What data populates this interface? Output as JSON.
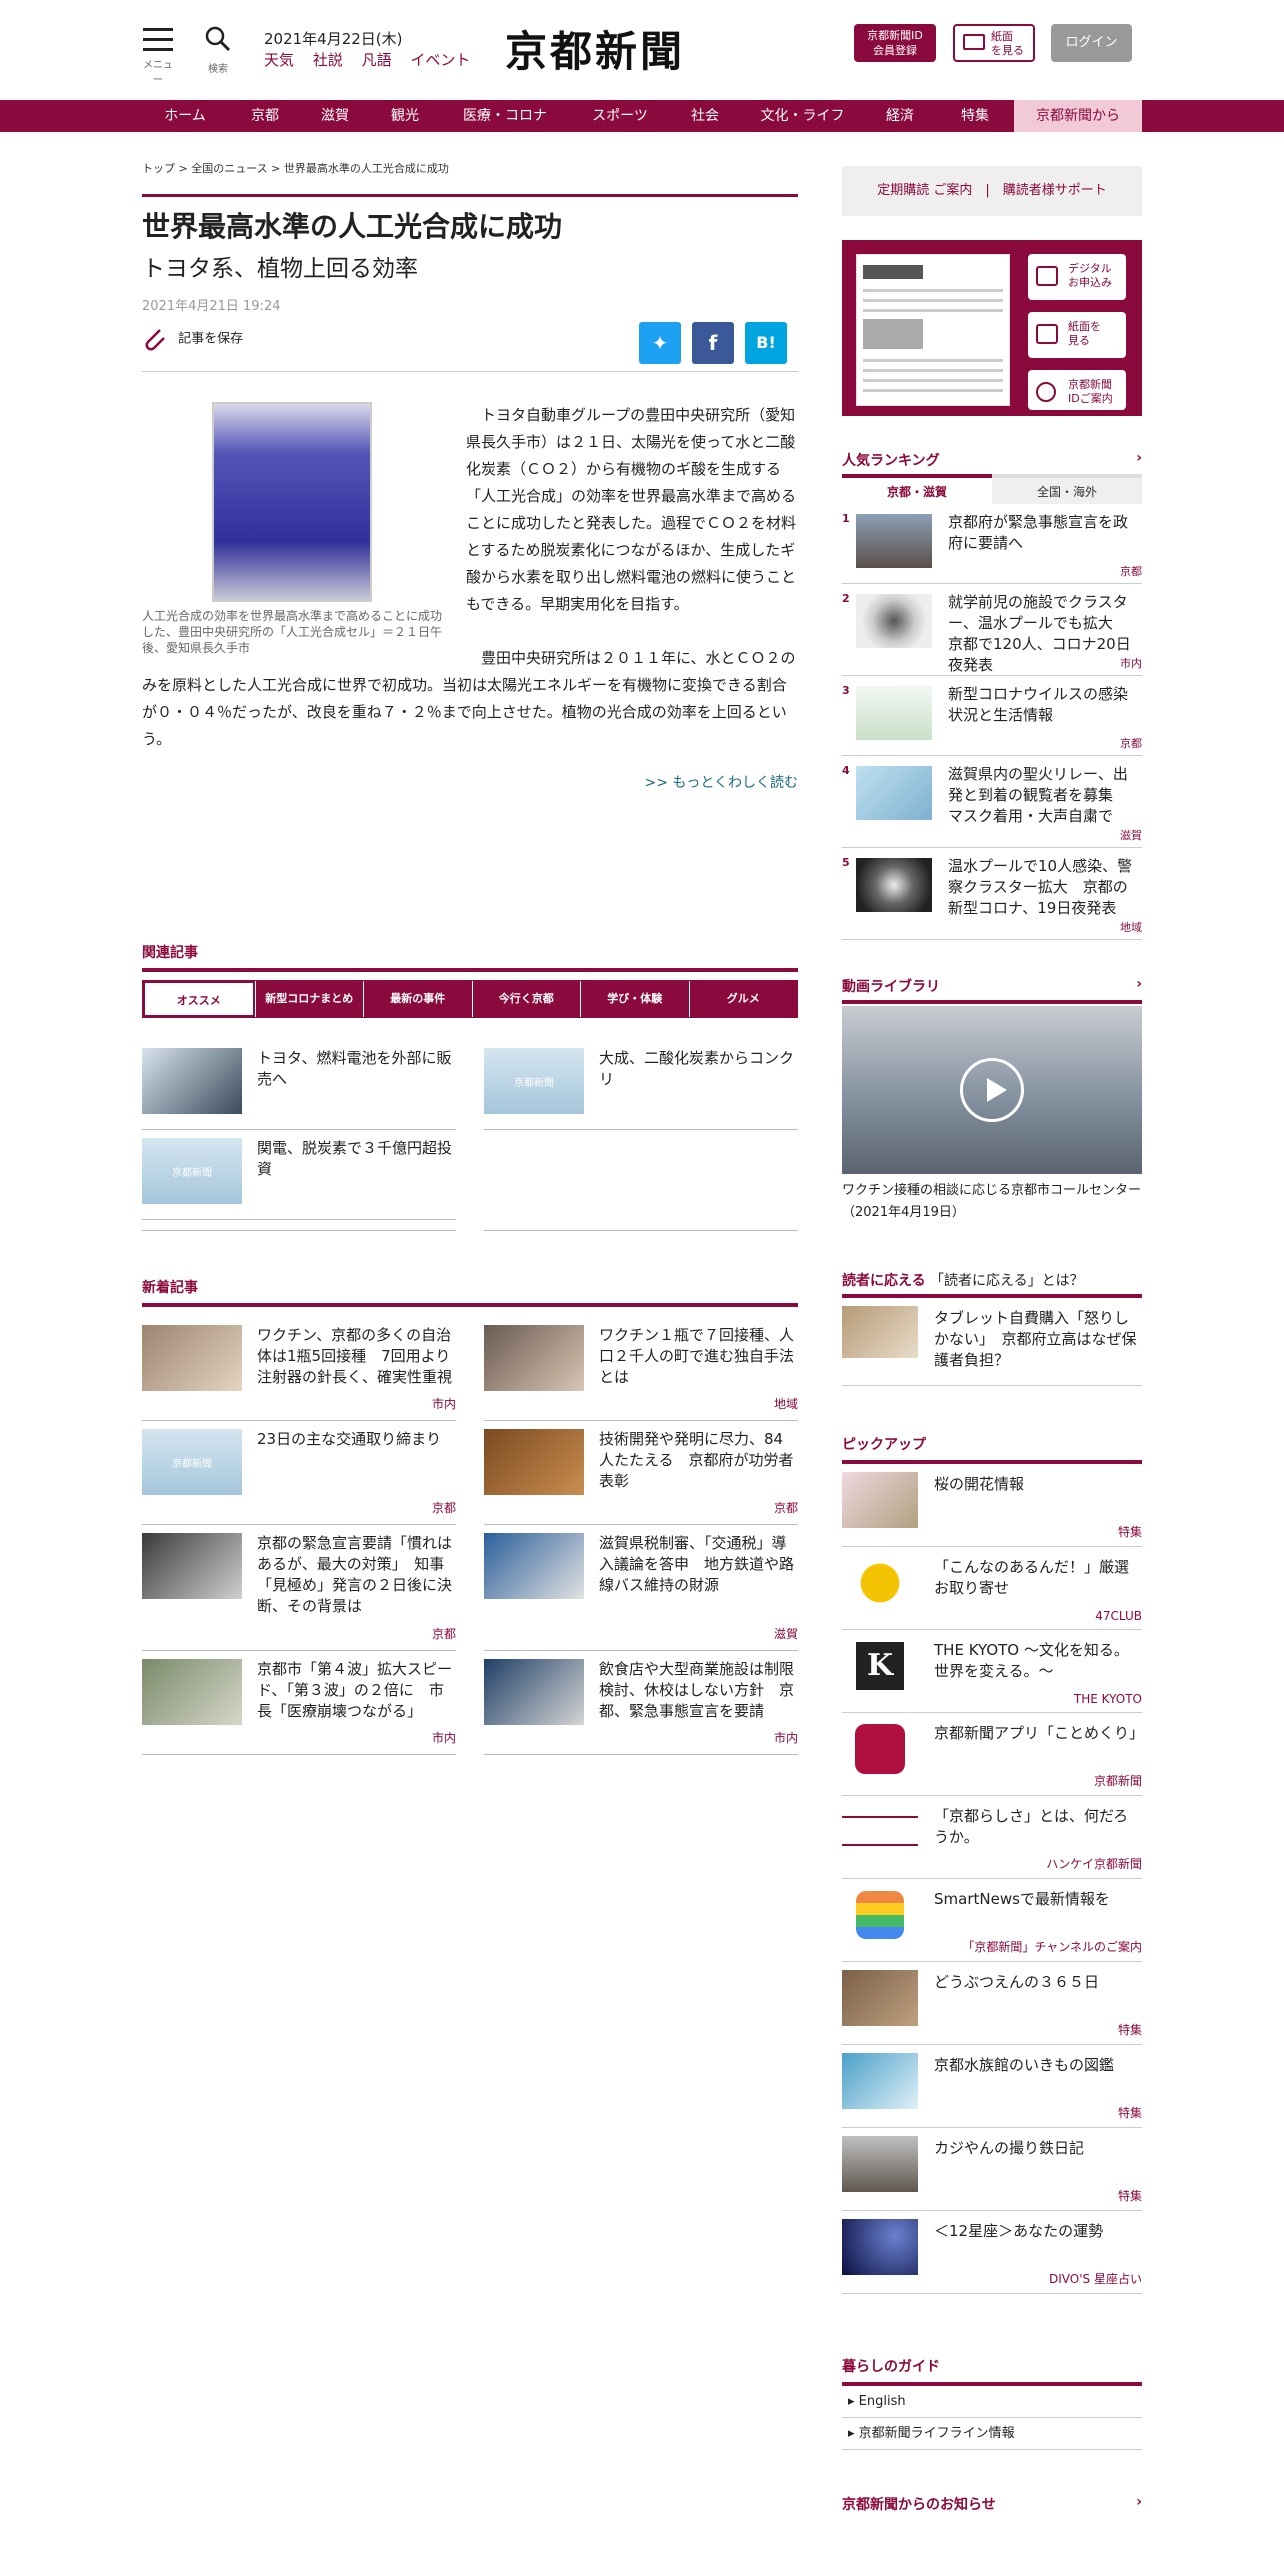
{
  "header": {
    "menu_label": "メニュー",
    "search_label": "検索",
    "date": "2021年4月22日(木)",
    "links": [
      "天気",
      "社説",
      "凡語",
      "イベント"
    ],
    "logo": "京都新聞",
    "id_button": "京都新聞ID\n会員登録",
    "paper_button": "紙面\nを見る",
    "login_button": "ログイン"
  },
  "nav": [
    "ホーム",
    "京都",
    "滋賀",
    "観光",
    "医療・コロナ",
    "スポーツ",
    "社会",
    "文化・ライフ",
    "経済",
    "特集",
    "京都新聞から"
  ],
  "article": {
    "breadcrumb": [
      "トップ",
      "全国のニュース",
      "世界最高水準の人工光合成に成功"
    ],
    "title": "世界最高水準の人工光合成に成功",
    "subtitle": "トヨタ系、植物上回る効率",
    "date": "2021年4月21日 19:24",
    "save_label": "記事を保存",
    "caption": "人工光合成の効率を世界最高水準まで高めることに成功した、豊田中央研究所の「人工光合成セル」＝２１日午後、愛知県長久手市",
    "para1": "トヨタ自動車グループの豊田中央研究所（愛知県長久手市）は２１日、太陽光を使って水と二酸化炭素（ＣＯ２）から有機物のギ酸を生成する「人工光合成」の効率を世界最高水準まで高めることに成功したと発表した。過程でＣＯ２を材料とするため脱炭素化につながるほか、生成したギ酸から水素を取り出し燃料電池の燃料に使うこともできる。早期実用化を目指す。",
    "para2": "豊田中央研究所は２０１１年に、水とＣＯ２のみを原料とした人工光合成に世界で初成功。当初は太陽光エネルギーを有機物に変換できる割合が０・０４％だったが、改良を重ね７・２％まで向上させた。植物の光合成の効率を上回るという。",
    "more": ">> もっとくわしく読む"
  },
  "related": {
    "heading": "関連記事",
    "tabs": [
      "オススメ",
      "新型コロナまとめ",
      "最新の事件",
      "今行く京都",
      "学び・体験",
      "グルメ"
    ],
    "items": [
      "トヨタ、燃料電池を外部に販売へ",
      "大成、二酸化炭素からコンクリ",
      "関電、脱炭素で３千億円超投資"
    ]
  },
  "latest": {
    "heading": "新着記事",
    "items": [
      {
        "title": "ワクチン、京都の多くの自治体は1瓶5回接種　7回用より注射器の針長く、確実性重視",
        "tag": "市内"
      },
      {
        "title": "ワクチン１瓶で７回接種、人口２千人の町で進む独自手法とは",
        "tag": "地域"
      },
      {
        "title": "23日の主な交通取り締まり",
        "tag": "京都"
      },
      {
        "title": "技術開発や発明に尽力、84人たたえる　京都府が功労者表彰",
        "tag": "京都"
      },
      {
        "title": "京都の緊急宣言要請「慣れはあるが、最大の対策」　知事「見極め」発言の２日後に決断、その背景は",
        "tag": "京都"
      },
      {
        "title": "滋賀県税制審、「交通税」導入議論を答申　地方鉄道や路線バス維持の財源",
        "tag": "滋賀"
      },
      {
        "title": "京都市「第４波」拡大スピード、「第３波」の２倍に　市長「医療崩壊つながる」",
        "tag": "市内"
      },
      {
        "title": "飲食店や大型商業施設は制限検討、休校はしない方針　京都、緊急事態宣言を要請",
        "tag": "市内"
      }
    ]
  },
  "sidebar": {
    "subscribe": "定期購読 ご案内",
    "support": "購読者様サポート",
    "epaper_buttons": [
      "デジタル\nお申込み",
      "紙面を\n見る",
      "京都新聞\nIDご案内"
    ],
    "ranking_heading": "人気ランキング",
    "ranking_tabs": [
      "京都・滋賀",
      "全国・海外"
    ],
    "ranking": [
      {
        "no": "1",
        "title": "京都府が緊急事態宣言を政府に要請へ",
        "tag": "京都"
      },
      {
        "no": "2",
        "title": "就学前児の施設でクラスター、温水プールでも拡大　京都で120人、コロナ20日夜発表",
        "tag": "市内"
      },
      {
        "no": "3",
        "title": "新型コロナウイルスの感染状況と生活情報",
        "tag": "京都"
      },
      {
        "no": "4",
        "title": "滋賀県内の聖火リレー、出発と到着の観覧者を募集　マスク着用・大声自粛で",
        "tag": "滋賀"
      },
      {
        "no": "5",
        "title": "温水プールで10人感染、警察クラスター拡大　京都の新型コロナ、19日夜発表",
        "tag": "地域"
      }
    ],
    "video_heading": "動画ライブラリ",
    "video_caption": "ワクチン接種の相談に応じる京都市コールセンター（2021年4月19日）",
    "reader_heading": "読者に応える",
    "reader_sub": "「読者に応える」とは？",
    "reader_item": "タブレット自費購入「怒りしかない」　京都府立高はなぜ保護者負担？",
    "pickup_heading": "ピックアップ",
    "pickup": [
      {
        "title": "桜の開花情報",
        "tag": "特集"
      },
      {
        "title": "「こんなのあるんだ！」厳選お取り寄せ",
        "tag": "47CLUB"
      },
      {
        "title": "THE KYOTO ～文化を知る。世界を変える。～",
        "tag": "THE KYOTO"
      },
      {
        "title": "京都新聞アプリ「ことめくり」",
        "tag": "京都新聞"
      },
      {
        "title": "「京都らしさ」とは、何だろうか。",
        "tag": "ハンケイ京都新聞"
      },
      {
        "title": "SmartNewsで最新情報を",
        "tag": "「京都新聞」チャンネルのご案内"
      },
      {
        "title": "どうぶつえんの３６５日",
        "tag": "特集"
      },
      {
        "title": "京都水族館のいきもの図鑑",
        "tag": "特集"
      },
      {
        "title": "カジやんの撮り鉄日記",
        "tag": "特集"
      },
      {
        "title": "＜12星座＞あなたの運勢",
        "tag": "DIVO'S 星座占い"
      }
    ],
    "guide_heading": "暮らしのガイド",
    "guide": [
      "English",
      "京都新聞ライフライン情報"
    ],
    "notice_heading": "京都新聞からのお知らせ"
  },
  "colors": {
    "brand": "#8b0a3e",
    "link": "#1b6a8a",
    "twitter": "#1da1f2",
    "facebook": "#3b5998",
    "hatena": "#00a4de"
  }
}
